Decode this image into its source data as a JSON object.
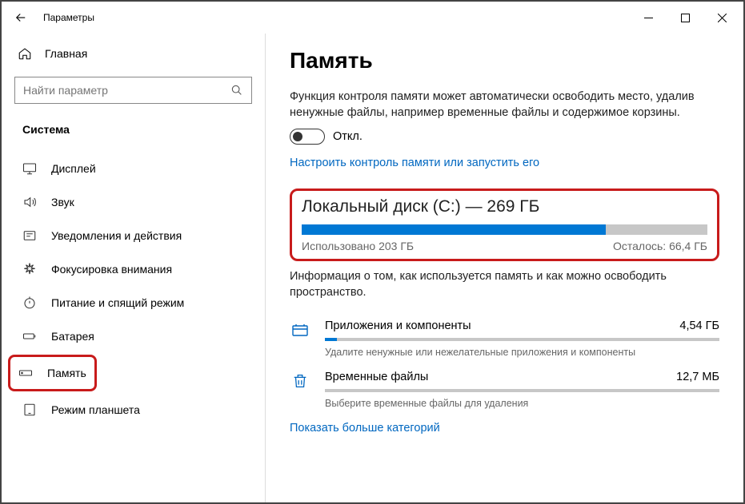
{
  "window": {
    "title": "Параметры"
  },
  "sidebar": {
    "home": "Главная",
    "search_placeholder": "Найти параметр",
    "section": "Система",
    "items": [
      {
        "label": "Дисплей"
      },
      {
        "label": "Звук"
      },
      {
        "label": "Уведомления и действия"
      },
      {
        "label": "Фокусировка внимания"
      },
      {
        "label": "Питание и спящий режим"
      },
      {
        "label": "Батарея"
      },
      {
        "label": "Память"
      },
      {
        "label": "Режим планшета"
      }
    ]
  },
  "page": {
    "title": "Память",
    "description": "Функция контроля памяти может автоматически освободить место, удалив ненужные файлы, например временные файлы и содержимое корзины.",
    "toggle_label": "Откл.",
    "config_link": "Настроить контроль памяти или запустить его",
    "disk": {
      "title": "Локальный диск (C:) — 269 ГБ",
      "used_label": "Использовано 203 ГБ",
      "left_label": "Осталось: 66,4 ГБ",
      "used_percent": 75
    },
    "info": "Информация о том, как используется память и как можно освободить пространство.",
    "categories": [
      {
        "name": "Приложения и компоненты",
        "size": "4,54 ГБ",
        "desc": "Удалите ненужные или нежелательные приложения и компоненты",
        "fill": 3
      },
      {
        "name": "Временные файлы",
        "size": "12,7 МБ",
        "desc": "Выберите временные файлы для удаления",
        "fill": 0
      }
    ],
    "more_link": "Показать больше категорий"
  }
}
